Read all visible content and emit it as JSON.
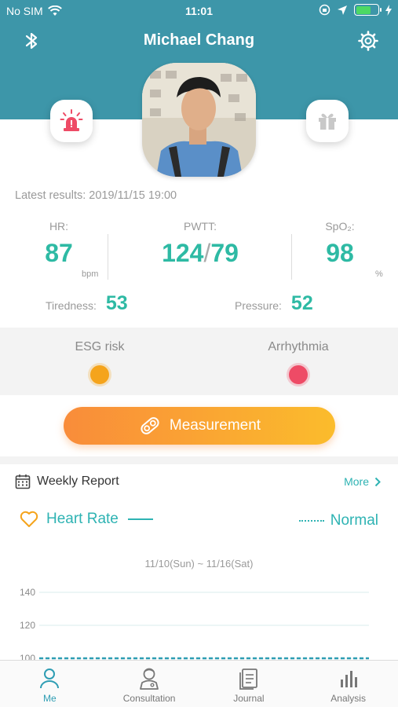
{
  "status_bar": {
    "carrier": "No SIM",
    "time": "11:01"
  },
  "header": {
    "title": "Michael Chang"
  },
  "latest_results": "Latest results: 2019/11/15 19:00",
  "metrics": {
    "hr": {
      "label": "HR:",
      "value": "87",
      "unit": "bpm"
    },
    "pwtt": {
      "label": "PWTT:",
      "systolic": "124",
      "separator": "/",
      "diastolic": "79"
    },
    "spo2": {
      "label": "SpO₂:",
      "value": "98",
      "unit": "%"
    },
    "tiredness": {
      "label": "Tiredness:",
      "value": "53"
    },
    "pressure": {
      "label": "Pressure:",
      "value": "52"
    }
  },
  "risk": {
    "esg": {
      "label": "ESG risk",
      "color": "#f5a41c"
    },
    "arrhythmia": {
      "label": "Arrhythmia",
      "color": "#ee4b66"
    }
  },
  "measurement_button": "Measurement",
  "weekly_report": {
    "title": "Weekly Report",
    "more": "More",
    "legend_heart_rate": "Heart Rate",
    "legend_normal": "Normal",
    "date_range": "11/10(Sun) ~ 11/16(Sat)"
  },
  "chart_data": {
    "type": "line",
    "y_ticks": [
      "140",
      "120",
      "100"
    ],
    "normal_line": 100
  },
  "tabs": [
    {
      "label": "Me",
      "icon": "person-icon",
      "active": true
    },
    {
      "label": "Consultation",
      "icon": "doctor-icon",
      "active": false
    },
    {
      "label": "Journal",
      "icon": "document-icon",
      "active": false
    },
    {
      "label": "Analysis",
      "icon": "bar-chart-icon",
      "active": false
    }
  ],
  "colors": {
    "header_bg": "#3d96a9",
    "accent_teal": "#2ebaa4",
    "measure_gradient_start": "#f98c3a",
    "measure_gradient_end": "#fbbc2c"
  }
}
